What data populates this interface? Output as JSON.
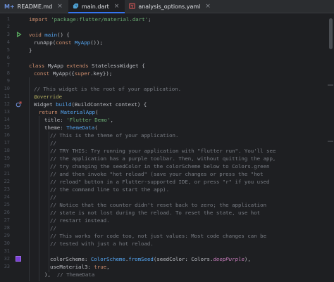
{
  "tabs": [
    {
      "icon": "M+",
      "label": "README.md",
      "icon_color": "#6a8fd8"
    },
    {
      "icon": "dart",
      "label": "main.dart",
      "icon_color": "#4ea1d3"
    },
    {
      "icon": "yaml",
      "label": "analysis_options.yaml",
      "icon_color": "#cc5555"
    }
  ],
  "close_glyph": "×",
  "line_numbers": [
    "1",
    "2",
    "3",
    "4",
    "5",
    "6",
    "7",
    "8",
    "9",
    "10",
    "11",
    "12",
    "13",
    "14",
    "15",
    "16",
    "17",
    "18",
    "19",
    "20",
    "21",
    "22",
    "23",
    "24",
    "25",
    "26",
    "27",
    "28",
    "29",
    "30",
    "31",
    "32",
    "33"
  ],
  "code": {
    "l1": {
      "kw": "import",
      "str": "'package:flutter/material.dart'",
      "tail": ";"
    },
    "l3": {
      "kw": "void",
      "fn": "main",
      "tail": "() {"
    },
    "l4": {
      "a": "runApp(",
      "kw": "const",
      "cls": "MyApp",
      "tail": "());"
    },
    "l5": {
      "tail": "}"
    },
    "l7": {
      "kw1": "class",
      "cls": "MyApp",
      "kw2": "extends",
      "tail": "StatelessWidget {"
    },
    "l8": {
      "kw": "const",
      "a": "MyApp({",
      "kw2": "super",
      "tail": ".key});"
    },
    "l10": {
      "cmt": "// This widget is the root of your application."
    },
    "l11": {
      "ann": "@override"
    },
    "l12": {
      "a": "Widget",
      "fn": "build",
      "tail": "(BuildContext context) {"
    },
    "l13": {
      "kw": "return",
      "cls": "MaterialApp",
      "tail": "("
    },
    "l14": {
      "a": "title:",
      "str": "'Flutter Demo'",
      "tail": ","
    },
    "l15": {
      "a": "theme:",
      "cls": "ThemeData",
      "tail": "("
    },
    "l16": {
      "cmt": "// This is the theme of your application."
    },
    "l17": {
      "cmt": "//"
    },
    "l18": {
      "cmt": "// TRY THIS: Try running your application with \"flutter run\". You'll see"
    },
    "l19": {
      "cmt": "// the application has a purple toolbar. Then, without quitting the app,"
    },
    "l20": {
      "cmt": "// try changing the seedColor in the colorScheme below to Colors.green"
    },
    "l21": {
      "cmt": "// and then invoke \"hot reload\" (save your changes or press the \"hot"
    },
    "l22": {
      "cmt": "// reload\" button in a Flutter-supported IDE, or press \"r\" if you used"
    },
    "l23": {
      "cmt": "// the command line to start the app)."
    },
    "l24": {
      "cmt": "//"
    },
    "l25": {
      "cmt": "// Notice that the counter didn't reset back to zero; the application"
    },
    "l26": {
      "cmt": "// state is not lost during the reload. To reset the state, use hot"
    },
    "l27": {
      "cmt": "// restart instead."
    },
    "l28": {
      "cmt": "//"
    },
    "l29": {
      "cmt": "// This works for code too, not just values: Most code changes can be"
    },
    "l30": {
      "cmt": "// tested with just a hot reload."
    },
    "l31": {
      "a": "colorScheme:",
      "cls": "ColorScheme",
      "dot": ".",
      "fn": "fromSeed",
      "b": "(seedColor: Colors.",
      "ital": "deepPurple",
      "tail": "),"
    },
    "l32": {
      "a": "useMaterial3:",
      "kw": "true",
      "tail": ","
    },
    "l33": {
      "a": "),",
      "cmt": "// ThemeData"
    }
  },
  "gutter_icons": {
    "run_line": "3",
    "run_icon": "run-icon",
    "override_line": "12",
    "override_icon": "override-icon",
    "color_line": "31",
    "color_swatch": "#7b3fd6"
  },
  "colors": {
    "background": "#1e1f22",
    "keyword": "#cf8e6d",
    "string": "#6aab73",
    "class": "#56a8f5",
    "comment": "#7a7e85",
    "annotation": "#b3ae60",
    "accent": "#3574f0"
  }
}
